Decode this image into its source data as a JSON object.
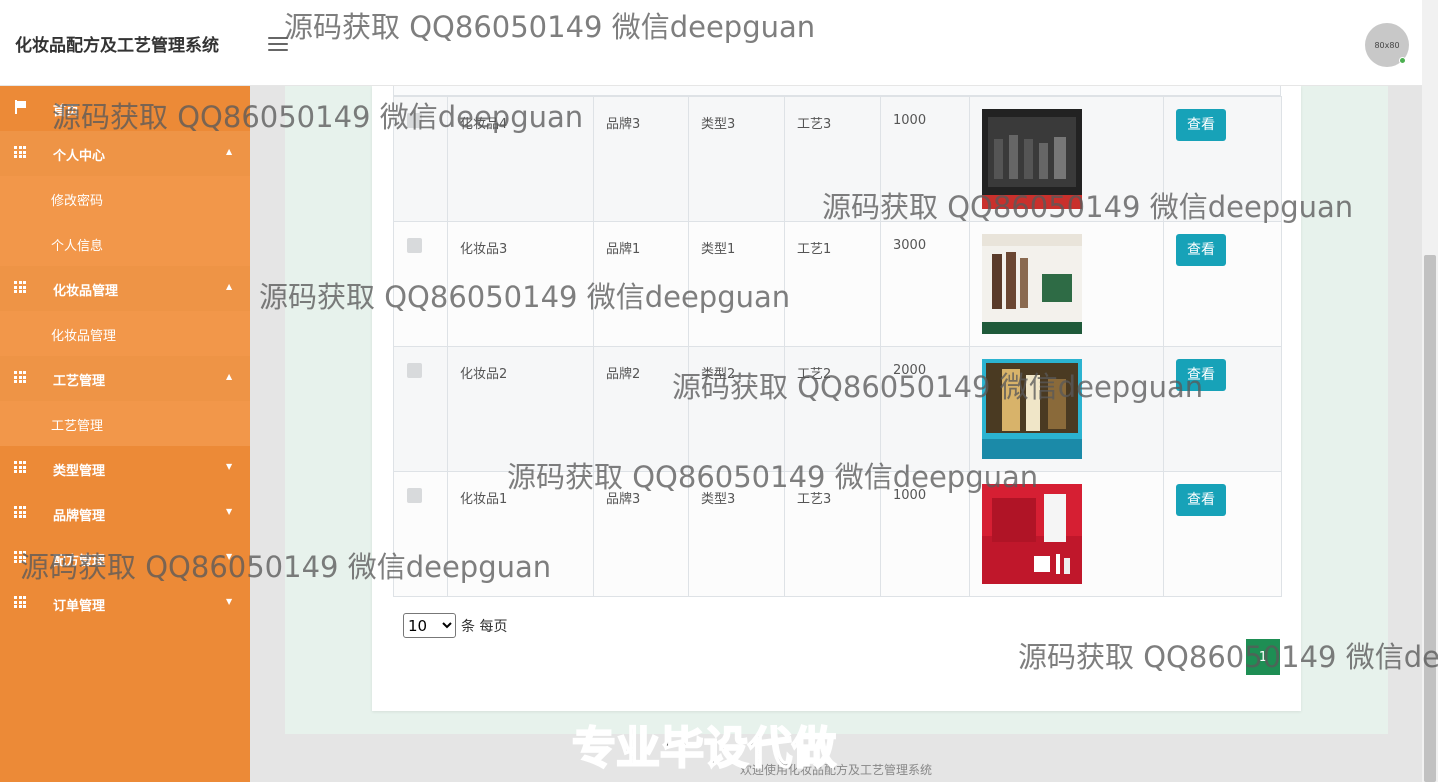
{
  "header": {
    "title": "化妆品配方及工艺管理系统",
    "avatar_text": "80x80"
  },
  "sidebar": {
    "items": [
      {
        "label": "首页",
        "icon": "flag-icon"
      },
      {
        "label": "个人中心",
        "icon": "grid-icon",
        "caret": "up",
        "children": [
          "修改密码",
          "个人信息"
        ]
      },
      {
        "label": "化妆品管理",
        "icon": "grid-icon",
        "caret": "up",
        "children": [
          "化妆品管理"
        ]
      },
      {
        "label": "工艺管理",
        "icon": "grid-icon",
        "caret": "up",
        "children": [
          "工艺管理"
        ]
      },
      {
        "label": "类型管理",
        "icon": "grid-icon",
        "caret": "down"
      },
      {
        "label": "品牌管理",
        "icon": "grid-icon",
        "caret": "down"
      },
      {
        "label": "配方管理",
        "icon": "grid-icon",
        "caret": "down"
      },
      {
        "label": "订单管理",
        "icon": "grid-icon",
        "caret": "down"
      }
    ]
  },
  "table": {
    "rows": [
      {
        "name": "化妆品4",
        "brand": "品牌3",
        "type": "类型3",
        "process": "工艺3",
        "price": "1000",
        "action": "查看"
      },
      {
        "name": "化妆品3",
        "brand": "品牌1",
        "type": "类型1",
        "process": "工艺1",
        "price": "3000",
        "action": "查看"
      },
      {
        "name": "化妆品2",
        "brand": "品牌2",
        "type": "类型2",
        "process": "工艺2",
        "price": "2000",
        "action": "查看"
      },
      {
        "name": "化妆品1",
        "brand": "品牌3",
        "type": "类型3",
        "process": "工艺3",
        "price": "1000",
        "action": "查看"
      }
    ]
  },
  "pager": {
    "page_size": "10",
    "options": [
      "10"
    ],
    "label": "条 每页",
    "current_page": "1"
  },
  "footer": {
    "text": "欢迎使用化妆品配方及工艺管理系统"
  },
  "watermarks": {
    "text": "源码获取 QQ86050149 微信deepguan",
    "text_cut": "源码获取 QQ86050149 微信de",
    "promo": "专业毕设代做"
  },
  "colors": {
    "sidebar": "#ec8a37",
    "accent_button": "#17a2b8",
    "pager_button": "#1e8e54"
  }
}
